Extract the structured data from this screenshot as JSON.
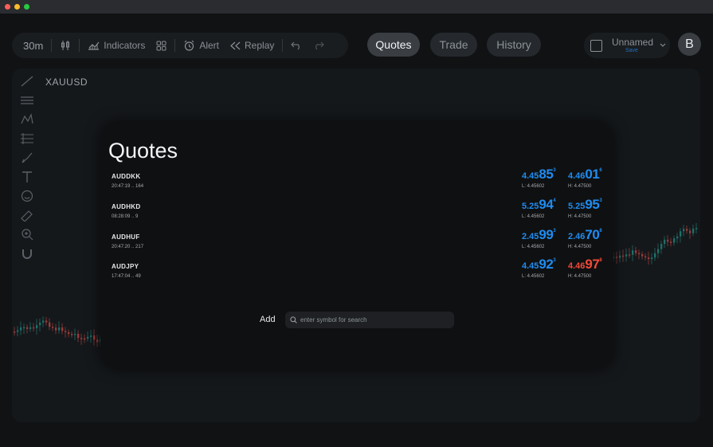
{
  "window": {
    "traffic_lights": [
      {
        "name": "close",
        "color": "#ff5f57"
      },
      {
        "name": "minimize",
        "color": "#febc2e"
      },
      {
        "name": "zoom",
        "color": "#28c840"
      }
    ]
  },
  "toolbar": {
    "timeframe": "30m",
    "indicators_label": "Indicators",
    "alert_label": "Alert",
    "replay_label": "Replay"
  },
  "nav": {
    "tabs": [
      {
        "label": "Quotes",
        "active": true
      },
      {
        "label": "Trade",
        "active": false
      },
      {
        "label": "History",
        "active": false
      }
    ]
  },
  "account": {
    "layout_name": "Unnamed",
    "save_label": "Save",
    "avatar_initial": "B"
  },
  "chart": {
    "symbol": "XAUUSD",
    "colors": {
      "up": "#26a69a",
      "down": "#ef5350"
    }
  },
  "quotes": {
    "title": "Quotes",
    "rows": [
      {
        "symbol": "AUDDKK",
        "meta": "20:47:19 .. 164",
        "bid": {
          "prefix": "4.45",
          "big": "85",
          "sup": "3",
          "color": "blue"
        },
        "ask": {
          "prefix": "4.46",
          "big": "01",
          "sup": "6",
          "color": "blue"
        },
        "low": "L: 4.45602",
        "high": "H: 4.47500"
      },
      {
        "symbol": "AUDHKD",
        "meta": "08:28:09 .. 9",
        "bid": {
          "prefix": "5.25",
          "big": "94",
          "sup": "4",
          "color": "blue"
        },
        "ask": {
          "prefix": "5.25",
          "big": "95",
          "sup": "3",
          "color": "blue"
        },
        "low": "L: 4.45602",
        "high": "H: 4.47500"
      },
      {
        "symbol": "AUDHUF",
        "meta": "20:47:20 .. 217",
        "bid": {
          "prefix": "2.45",
          "big": "99",
          "sup": "3",
          "color": "blue"
        },
        "ask": {
          "prefix": "2.46",
          "big": "70",
          "sup": "8",
          "color": "blue"
        },
        "low": "L: 4.45602",
        "high": "H: 4.47500"
      },
      {
        "symbol": "AUDJPY",
        "meta": "17:47:04 .. 49",
        "bid": {
          "prefix": "4.45",
          "big": "92",
          "sup": "3",
          "color": "blue"
        },
        "ask": {
          "prefix": "4.46",
          "big": "97",
          "sup": "8",
          "color": "red"
        },
        "low": "L: 4.45602",
        "high": "H: 4.47500"
      }
    ],
    "add_label": "Add",
    "search_placeholder": "enter symbol for search"
  }
}
